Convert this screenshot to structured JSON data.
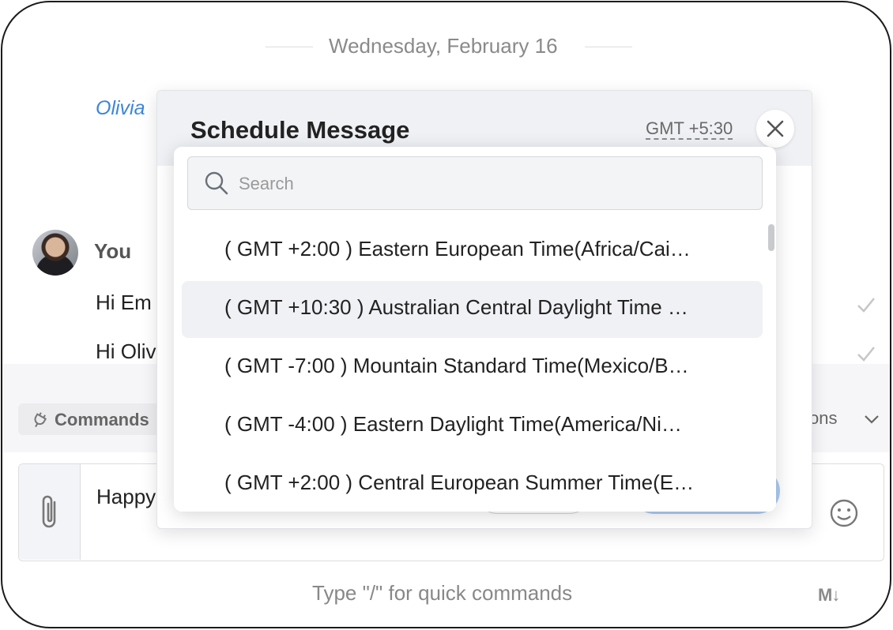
{
  "chat": {
    "date_separator": "Wednesday, February 16",
    "olivia_mention": "Olivia",
    "sender": "You",
    "messages": [
      "Hi Em",
      "Hi Oliv"
    ]
  },
  "toolbar": {
    "commands_label": "Commands",
    "options_label": "tions"
  },
  "composer": {
    "draft_text": "Happy",
    "hint": "Type \"/\" for quick commands",
    "markdown_icon": "M↓"
  },
  "modal": {
    "title": "Schedule Message",
    "current_timezone": "GMT +5:30",
    "close_icon": "close-icon"
  },
  "timezone_dropdown": {
    "search_placeholder": "Search",
    "items": [
      "( GMT +2:00 ) Eastern European Time(Africa/Cai…",
      "( GMT +10:30 ) Australian Central Daylight Time …",
      "( GMT -7:00 ) Mountain Standard Time(Mexico/B…",
      "( GMT -4:00 ) Eastern Daylight Time(America/Ni…",
      "( GMT +2:00 ) Central European Summer Time(E…"
    ],
    "highlighted_index": 1
  },
  "colors": {
    "accent": "#3d86d8",
    "primary_button": "#4a8fe0",
    "highlight": "#f0f1f5"
  }
}
